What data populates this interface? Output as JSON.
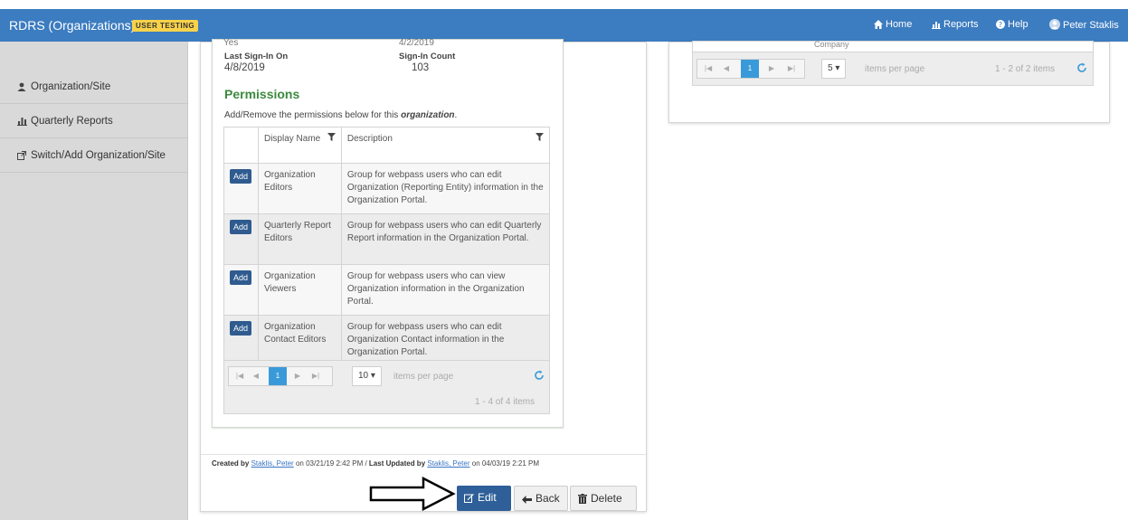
{
  "header": {
    "brand": "RDRS (Organizations)",
    "badge": "USER TESTING",
    "nav": {
      "home": "Home",
      "reports": "Reports",
      "help": "Help",
      "user": "Peter Staklis"
    }
  },
  "sidebar": {
    "items": [
      {
        "label": "Organization/Site",
        "icon": "user-icon"
      },
      {
        "label": "Quarterly Reports",
        "icon": "chart-icon"
      },
      {
        "label": "Switch/Add Organization/Site",
        "icon": "external-link-icon"
      }
    ]
  },
  "details": {
    "cut_left": "Yes",
    "cut_right": "4/2/2019",
    "last_signin_label": "Last Sign-In On",
    "last_signin_value": "4/8/2019",
    "signin_count_label": "Sign-In Count",
    "signin_count_value": "103"
  },
  "permissions": {
    "title": "Permissions",
    "desc_prefix": "Add/Remove the permissions below for this ",
    "desc_em": "organization",
    "desc_suffix": ".",
    "columns": {
      "display_name": "Display Name",
      "description": "Description"
    },
    "add_label": "Add",
    "rows": [
      {
        "name": "Organization Editors",
        "description": "Group for webpass users who can edit Organization (Reporting Entity) information in the Organization Portal."
      },
      {
        "name": "Quarterly Report Editors",
        "description": "Group for webpass users who can edit Quarterly Report information in the Organization Portal."
      },
      {
        "name": "Organization Viewers",
        "description": "Group for webpass users who can view Organization information in the Organization Portal."
      },
      {
        "name": "Organization Contact Editors",
        "description": "Group for webpass users who can edit Organization Contact information in the Organization Portal."
      }
    ],
    "pager": {
      "current_page": "1",
      "page_size": "10",
      "items_per_page": "items per page",
      "count": "1 - 4 of 4 items"
    }
  },
  "audit": {
    "created_by_label": "Created by",
    "created_by_name": "Staklis, Peter",
    "created_on": " on 03/21/19 2:42 PM  /  ",
    "updated_by_label": "Last Updated by",
    "updated_by_name": "Staklis, Peter",
    "updated_on": " on 04/03/19 2:21 PM"
  },
  "actions": {
    "edit": "Edit",
    "back": "Back",
    "delete": "Delete"
  },
  "right_grid": {
    "column_label": "Company",
    "pager": {
      "current_page": "1",
      "page_size": "5",
      "items_per_page": "items per page",
      "count": "1 - 2 of 2 items"
    }
  },
  "colors": {
    "navbar": "#3c7cc0",
    "badge": "#f7d24a",
    "section_title": "#3b8a3e",
    "primary_button": "#2f5f98",
    "page_active": "#3a9ad9"
  }
}
